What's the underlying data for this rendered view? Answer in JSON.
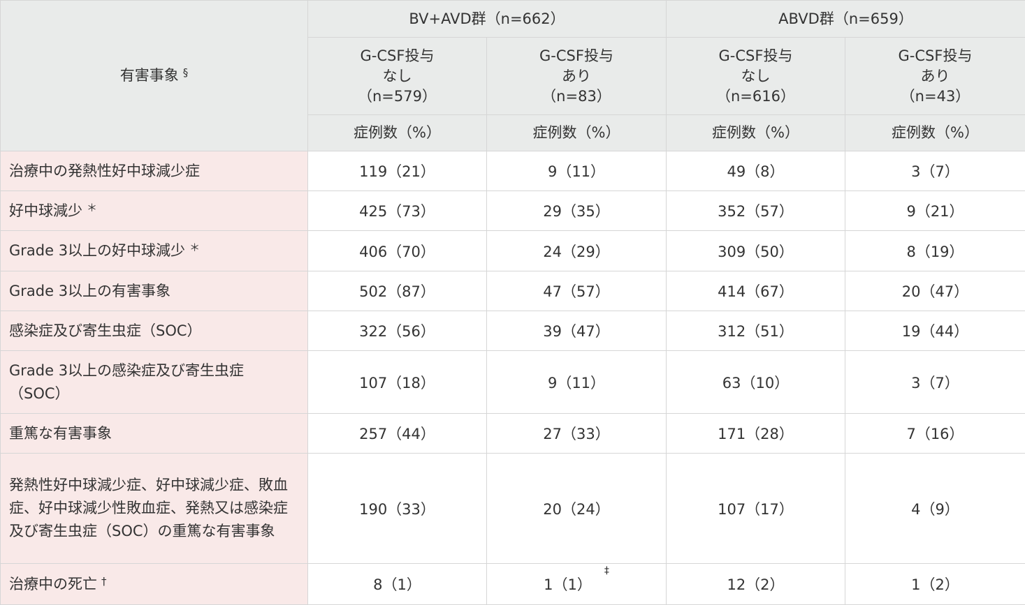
{
  "header": {
    "corner_label": "有害事象",
    "corner_note": "§",
    "groups": [
      {
        "label": "BV+AVD群（n=662）"
      },
      {
        "label": "ABVD群（n=659）"
      }
    ],
    "subgroups": [
      {
        "line1": "G-CSF投与",
        "line2": "なし",
        "line3": "（n=579）"
      },
      {
        "line1": "G-CSF投与",
        "line2": "あり",
        "line3": "（n=83）"
      },
      {
        "line1": "G-CSF投与",
        "line2": "なし",
        "line3": "（n=616）"
      },
      {
        "line1": "G-CSF投与",
        "line2": "あり",
        "line3": "（n=43）"
      }
    ],
    "unit_label": "症例数（%）"
  },
  "rows": [
    {
      "label": "治療中の発熱性好中球減少症",
      "note": "",
      "values": [
        "119（21）",
        "9（11）",
        "49（8）",
        "3（7）"
      ],
      "value_notes": [
        "",
        "",
        "",
        ""
      ]
    },
    {
      "label": "好中球減少",
      "note": "＊",
      "values": [
        "425（73）",
        "29（35）",
        "352（57）",
        "9（21）"
      ],
      "value_notes": [
        "",
        "",
        "",
        ""
      ]
    },
    {
      "label": "Grade 3以上の好中球減少",
      "note": "＊",
      "values": [
        "406（70）",
        "24（29）",
        "309（50）",
        "8（19）"
      ],
      "value_notes": [
        "",
        "",
        "",
        ""
      ]
    },
    {
      "label": "Grade 3以上の有害事象",
      "note": "",
      "values": [
        "502（87）",
        "47（57）",
        "414（67）",
        "20（47）"
      ],
      "value_notes": [
        "",
        "",
        "",
        ""
      ]
    },
    {
      "label": "感染症及び寄生虫症（SOC）",
      "note": "",
      "values": [
        "322（56）",
        "39（47）",
        "312（51）",
        "19（44）"
      ],
      "value_notes": [
        "",
        "",
        "",
        ""
      ]
    },
    {
      "label": "Grade 3以上の感染症及び寄生虫症（SOC）",
      "note": "",
      "values": [
        "107（18）",
        "9（11）",
        "63（10）",
        "3（7）"
      ],
      "value_notes": [
        "",
        "",
        "",
        ""
      ]
    },
    {
      "label": "重篤な有害事象",
      "note": "",
      "values": [
        "257（44）",
        "27（33）",
        "171（28）",
        "7（16）"
      ],
      "value_notes": [
        "",
        "",
        "",
        ""
      ]
    },
    {
      "label": "発熱性好中球減少症、好中球減少症、敗血症、好中球減少性敗血症、発熱又は感染症及び寄生虫症（SOC）の重篤な有害事象",
      "note": "",
      "values": [
        "190（33）",
        "20（24）",
        "107（17）",
        "4（9）"
      ],
      "value_notes": [
        "",
        "",
        "",
        ""
      ]
    },
    {
      "label": "治療中の死亡",
      "note": "†",
      "values": [
        "8（1）",
        "1（1）",
        "12（2）",
        "1（2）"
      ],
      "value_notes": [
        "",
        "‡",
        "",
        ""
      ]
    }
  ]
}
